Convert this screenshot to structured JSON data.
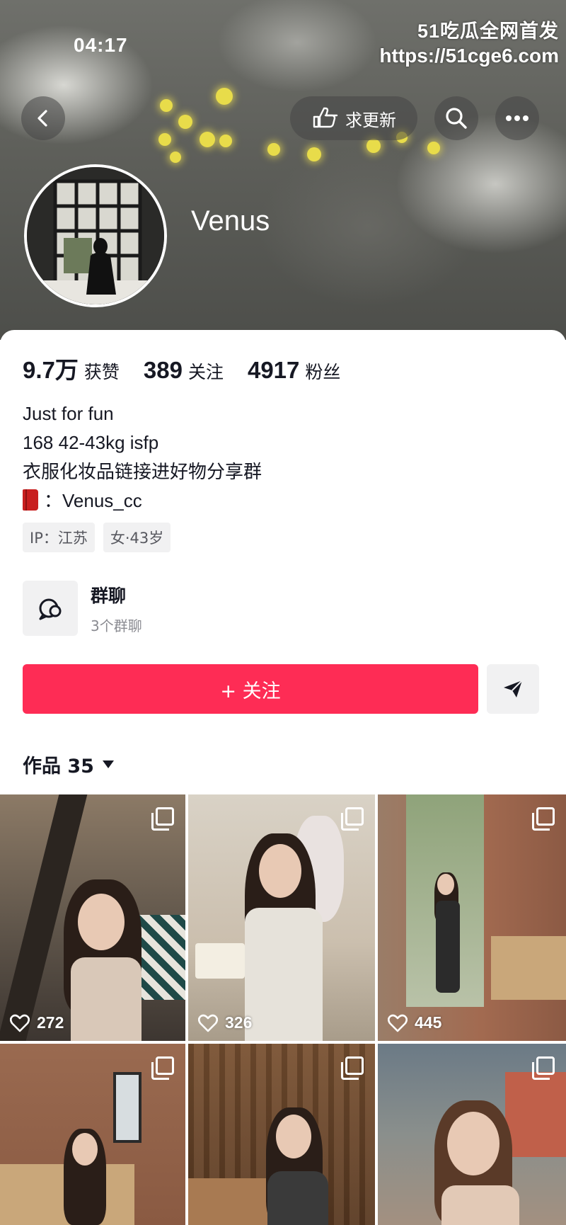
{
  "status_bar": {
    "time": "04:17"
  },
  "watermark": {
    "title": "51吃瓜全网首发",
    "url": "https://51cge6.com"
  },
  "header": {
    "back_icon": "chevron-left-icon",
    "request_update_label": "求更新",
    "request_update_icon": "hand-point-icon",
    "search_icon": "search-icon",
    "more_icon": "more-icon"
  },
  "profile": {
    "username": "Venus",
    "stats": [
      {
        "value": "9.7万",
        "label": "获赞"
      },
      {
        "value": "389",
        "label": "关注"
      },
      {
        "value": "4917",
        "label": "粉丝"
      }
    ],
    "bio": {
      "line1": "Just for fun",
      "line2": "168  42-43kg  isfp",
      "line3": "衣服化妆品链接进好物分享群",
      "line4_icon": "red-book-icon",
      "line4": "：Venus_cc"
    },
    "tags": [
      "IP：江苏",
      "女·43岁"
    ]
  },
  "group_chat": {
    "title": "群聊",
    "subtitle": "3个群聊"
  },
  "actions": {
    "follow_label": "+ 关注",
    "share_icon": "send-icon"
  },
  "works_tab": {
    "label": "作品 35"
  },
  "posts": [
    {
      "likes": "272"
    },
    {
      "likes": "326"
    },
    {
      "likes": "445"
    },
    {
      "likes": ""
    },
    {
      "likes": ""
    },
    {
      "likes": ""
    }
  ],
  "colors": {
    "accent": "#fe2c55",
    "text": "#161823",
    "muted": "#8a8b91",
    "tag_bg": "#f1f1f2"
  }
}
